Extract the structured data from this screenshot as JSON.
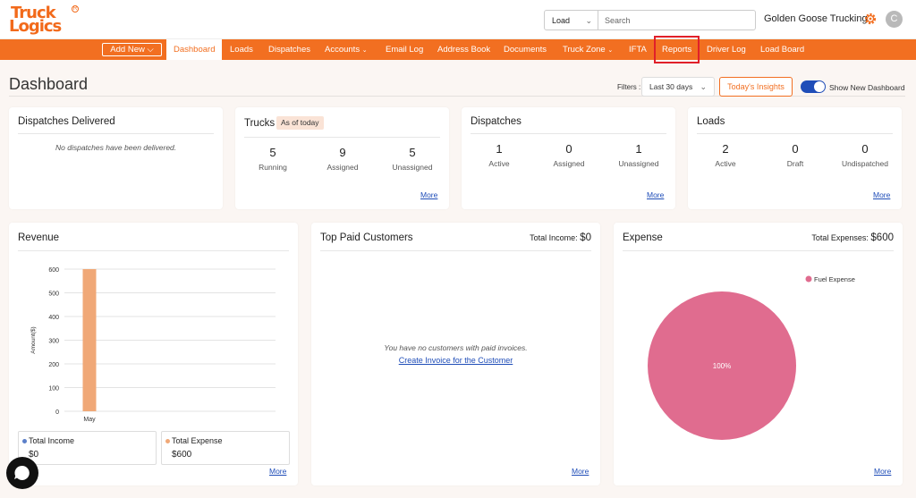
{
  "brand": {
    "line1": "Truck",
    "line2": "Logics",
    "reg": "R"
  },
  "search": {
    "type": "Load",
    "placeholder": "Search"
  },
  "company": "Golden Goose Trucking",
  "user_initial": "C",
  "nav": {
    "add_new": "Add New",
    "items": [
      "Dashboard",
      "Loads",
      "Dispatches",
      "Accounts",
      "Email Log",
      "Address Book",
      "Documents",
      "Truck Zone",
      "IFTA",
      "Reports",
      "Driver Log",
      "Load Board"
    ]
  },
  "page": {
    "title": "Dashboard",
    "filters_label": "Filters :",
    "filter_value": "Last 30 days",
    "insights_button": "Today's Insights",
    "toggle_label": "Show New Dashboard"
  },
  "cards": {
    "dispatches_delivered": {
      "title": "Dispatches Delivered",
      "empty": "No dispatches have been delivered."
    },
    "trucks": {
      "title": "Trucks",
      "badge": "As of today",
      "stats": [
        {
          "num": "5",
          "label": "Running"
        },
        {
          "num": "9",
          "label": "Assigned"
        },
        {
          "num": "5",
          "label": "Unassigned"
        }
      ],
      "more": "More"
    },
    "dispatches": {
      "title": "Dispatches",
      "stats": [
        {
          "num": "1",
          "label": "Active"
        },
        {
          "num": "0",
          "label": "Assigned"
        },
        {
          "num": "1",
          "label": "Unassigned"
        }
      ],
      "more": "More"
    },
    "loads": {
      "title": "Loads",
      "stats": [
        {
          "num": "2",
          "label": "Active"
        },
        {
          "num": "0",
          "label": "Draft"
        },
        {
          "num": "0",
          "label": "Undispatched"
        }
      ],
      "more": "More"
    },
    "revenue": {
      "title": "Revenue",
      "legend": [
        {
          "label": "Total Income",
          "value": "$0"
        },
        {
          "label": "Total Expense",
          "value": "$600"
        }
      ],
      "more": "More"
    },
    "top_customers": {
      "title": "Top Paid Customers",
      "total_label": "Total Income:",
      "total_value": "$0",
      "empty": "You have no customers with paid invoices.",
      "link": "Create Invoice for the Customer",
      "more": "More"
    },
    "expense": {
      "title": "Expense",
      "total_label": "Total Expenses:",
      "total_value": "$600",
      "more": "More"
    }
  },
  "colors": {
    "accent": "#f26f21",
    "income": "#5b7fc9",
    "expense_bar": "#f0a877",
    "fuel": "#e06c8f",
    "link": "#1f4db8"
  },
  "chart_data": [
    {
      "type": "bar",
      "categories": [
        "May"
      ],
      "series": [
        {
          "name": "Total Expense",
          "values": [
            600
          ]
        }
      ],
      "ylabel": "Amount($)",
      "ylim": [
        0,
        600
      ],
      "yticks": [
        0,
        100,
        200,
        300,
        400,
        500,
        600
      ],
      "grid": true
    },
    {
      "type": "pie",
      "labels": [
        "Fuel Expense"
      ],
      "values": [
        100
      ],
      "slice_label": "100%",
      "legend": "top-right"
    }
  ]
}
